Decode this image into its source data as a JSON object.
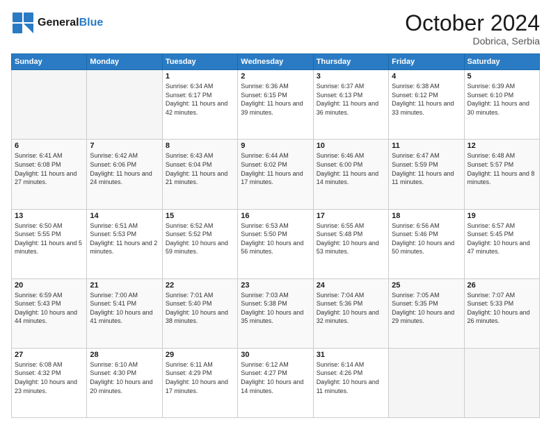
{
  "logo": {
    "general": "General",
    "blue": "Blue"
  },
  "header": {
    "month": "October 2024",
    "location": "Dobrica, Serbia"
  },
  "days_of_week": [
    "Sunday",
    "Monday",
    "Tuesday",
    "Wednesday",
    "Thursday",
    "Friday",
    "Saturday"
  ],
  "weeks": [
    [
      {
        "day": "",
        "info": ""
      },
      {
        "day": "",
        "info": ""
      },
      {
        "day": "1",
        "info": "Sunrise: 6:34 AM\nSunset: 6:17 PM\nDaylight: 11 hours and 42 minutes."
      },
      {
        "day": "2",
        "info": "Sunrise: 6:36 AM\nSunset: 6:15 PM\nDaylight: 11 hours and 39 minutes."
      },
      {
        "day": "3",
        "info": "Sunrise: 6:37 AM\nSunset: 6:13 PM\nDaylight: 11 hours and 36 minutes."
      },
      {
        "day": "4",
        "info": "Sunrise: 6:38 AM\nSunset: 6:12 PM\nDaylight: 11 hours and 33 minutes."
      },
      {
        "day": "5",
        "info": "Sunrise: 6:39 AM\nSunset: 6:10 PM\nDaylight: 11 hours and 30 minutes."
      }
    ],
    [
      {
        "day": "6",
        "info": "Sunrise: 6:41 AM\nSunset: 6:08 PM\nDaylight: 11 hours and 27 minutes."
      },
      {
        "day": "7",
        "info": "Sunrise: 6:42 AM\nSunset: 6:06 PM\nDaylight: 11 hours and 24 minutes."
      },
      {
        "day": "8",
        "info": "Sunrise: 6:43 AM\nSunset: 6:04 PM\nDaylight: 11 hours and 21 minutes."
      },
      {
        "day": "9",
        "info": "Sunrise: 6:44 AM\nSunset: 6:02 PM\nDaylight: 11 hours and 17 minutes."
      },
      {
        "day": "10",
        "info": "Sunrise: 6:46 AM\nSunset: 6:00 PM\nDaylight: 11 hours and 14 minutes."
      },
      {
        "day": "11",
        "info": "Sunrise: 6:47 AM\nSunset: 5:59 PM\nDaylight: 11 hours and 11 minutes."
      },
      {
        "day": "12",
        "info": "Sunrise: 6:48 AM\nSunset: 5:57 PM\nDaylight: 11 hours and 8 minutes."
      }
    ],
    [
      {
        "day": "13",
        "info": "Sunrise: 6:50 AM\nSunset: 5:55 PM\nDaylight: 11 hours and 5 minutes."
      },
      {
        "day": "14",
        "info": "Sunrise: 6:51 AM\nSunset: 5:53 PM\nDaylight: 11 hours and 2 minutes."
      },
      {
        "day": "15",
        "info": "Sunrise: 6:52 AM\nSunset: 5:52 PM\nDaylight: 10 hours and 59 minutes."
      },
      {
        "day": "16",
        "info": "Sunrise: 6:53 AM\nSunset: 5:50 PM\nDaylight: 10 hours and 56 minutes."
      },
      {
        "day": "17",
        "info": "Sunrise: 6:55 AM\nSunset: 5:48 PM\nDaylight: 10 hours and 53 minutes."
      },
      {
        "day": "18",
        "info": "Sunrise: 6:56 AM\nSunset: 5:46 PM\nDaylight: 10 hours and 50 minutes."
      },
      {
        "day": "19",
        "info": "Sunrise: 6:57 AM\nSunset: 5:45 PM\nDaylight: 10 hours and 47 minutes."
      }
    ],
    [
      {
        "day": "20",
        "info": "Sunrise: 6:59 AM\nSunset: 5:43 PM\nDaylight: 10 hours and 44 minutes."
      },
      {
        "day": "21",
        "info": "Sunrise: 7:00 AM\nSunset: 5:41 PM\nDaylight: 10 hours and 41 minutes."
      },
      {
        "day": "22",
        "info": "Sunrise: 7:01 AM\nSunset: 5:40 PM\nDaylight: 10 hours and 38 minutes."
      },
      {
        "day": "23",
        "info": "Sunrise: 7:03 AM\nSunset: 5:38 PM\nDaylight: 10 hours and 35 minutes."
      },
      {
        "day": "24",
        "info": "Sunrise: 7:04 AM\nSunset: 5:36 PM\nDaylight: 10 hours and 32 minutes."
      },
      {
        "day": "25",
        "info": "Sunrise: 7:05 AM\nSunset: 5:35 PM\nDaylight: 10 hours and 29 minutes."
      },
      {
        "day": "26",
        "info": "Sunrise: 7:07 AM\nSunset: 5:33 PM\nDaylight: 10 hours and 26 minutes."
      }
    ],
    [
      {
        "day": "27",
        "info": "Sunrise: 6:08 AM\nSunset: 4:32 PM\nDaylight: 10 hours and 23 minutes."
      },
      {
        "day": "28",
        "info": "Sunrise: 6:10 AM\nSunset: 4:30 PM\nDaylight: 10 hours and 20 minutes."
      },
      {
        "day": "29",
        "info": "Sunrise: 6:11 AM\nSunset: 4:29 PM\nDaylight: 10 hours and 17 minutes."
      },
      {
        "day": "30",
        "info": "Sunrise: 6:12 AM\nSunset: 4:27 PM\nDaylight: 10 hours and 14 minutes."
      },
      {
        "day": "31",
        "info": "Sunrise: 6:14 AM\nSunset: 4:26 PM\nDaylight: 10 hours and 11 minutes."
      },
      {
        "day": "",
        "info": ""
      },
      {
        "day": "",
        "info": ""
      }
    ]
  ]
}
